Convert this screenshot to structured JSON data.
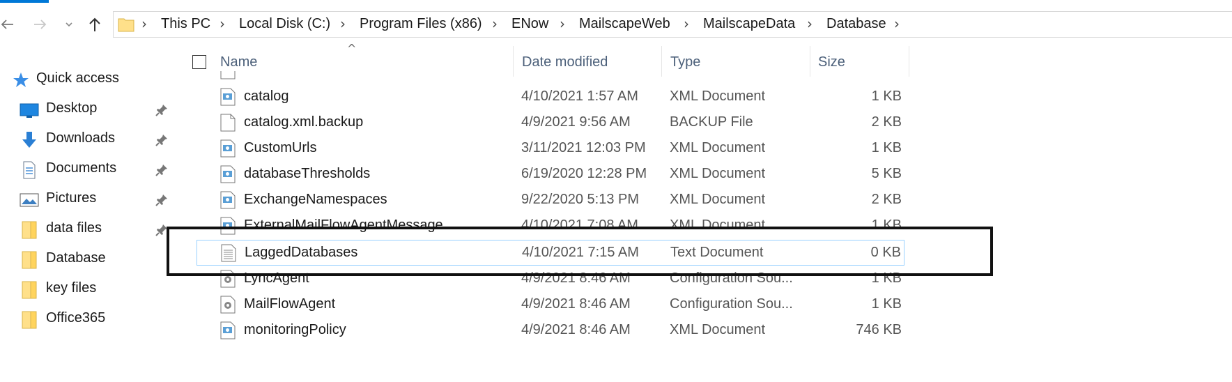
{
  "nav": {
    "back_icon": "back-arrow-icon",
    "forward_icon": "forward-arrow-icon",
    "recent_icon": "chevron-down-icon",
    "up_icon": "up-arrow-icon"
  },
  "address": {
    "crumbs": [
      "This PC",
      "Local Disk (C:)",
      "Program Files (x86)",
      "ENow",
      "MailscapeWeb",
      "MailscapeData",
      "Database"
    ]
  },
  "sidebar": {
    "items": [
      {
        "label": "Quick access",
        "icon": "star-icon",
        "pinned": false
      },
      {
        "label": "Desktop",
        "icon": "desktop-icon",
        "pinned": true
      },
      {
        "label": "Downloads",
        "icon": "download-icon",
        "pinned": true
      },
      {
        "label": "Documents",
        "icon": "documents-icon",
        "pinned": true
      },
      {
        "label": "Pictures",
        "icon": "pictures-icon",
        "pinned": true
      },
      {
        "label": "data files",
        "icon": "folder-icon",
        "pinned": true
      },
      {
        "label": "Database",
        "icon": "folder-icon",
        "pinned": false
      },
      {
        "label": "key files",
        "icon": "folder-icon",
        "pinned": false
      },
      {
        "label": "Office365",
        "icon": "folder-icon",
        "pinned": false
      }
    ]
  },
  "columns": {
    "name": "Name",
    "date": "Date modified",
    "type": "Type",
    "size": "Size"
  },
  "files": [
    {
      "name": "catalog",
      "date": "4/10/2021 1:57 AM",
      "type": "XML Document",
      "size": "1 KB",
      "icon": "xml-file-icon"
    },
    {
      "name": "catalog.xml.backup",
      "date": "4/9/2021 9:56 AM",
      "type": "BACKUP File",
      "size": "2 KB",
      "icon": "blank-file-icon"
    },
    {
      "name": "CustomUrls",
      "date": "3/11/2021 12:03 PM",
      "type": "XML Document",
      "size": "1 KB",
      "icon": "xml-file-icon"
    },
    {
      "name": "databaseThresholds",
      "date": "6/19/2020 12:28 PM",
      "type": "XML Document",
      "size": "5 KB",
      "icon": "xml-file-icon"
    },
    {
      "name": "ExchangeNamespaces",
      "date": "9/22/2020 5:13 PM",
      "type": "XML Document",
      "size": "2 KB",
      "icon": "xml-file-icon"
    },
    {
      "name": "ExternalMailFlowAgentMessage",
      "date": "4/10/2021 7:08 AM",
      "type": "XML Document",
      "size": "1 KB",
      "icon": "xml-file-icon"
    },
    {
      "name": "LaggedDatabases",
      "date": "4/10/2021 7:15 AM",
      "type": "Text Document",
      "size": "0 KB",
      "icon": "text-file-icon",
      "selected": true
    },
    {
      "name": "LyncAgent",
      "date": "4/9/2021 8:46 AM",
      "type": "Configuration Sou...",
      "size": "1 KB",
      "icon": "config-file-icon"
    },
    {
      "name": "MailFlowAgent",
      "date": "4/9/2021 8:46 AM",
      "type": "Configuration Sou...",
      "size": "1 KB",
      "icon": "config-file-icon"
    },
    {
      "name": "monitoringPolicy",
      "date": "4/9/2021 8:46 AM",
      "type": "XML Document",
      "size": "746 KB",
      "icon": "xml-file-icon"
    }
  ]
}
